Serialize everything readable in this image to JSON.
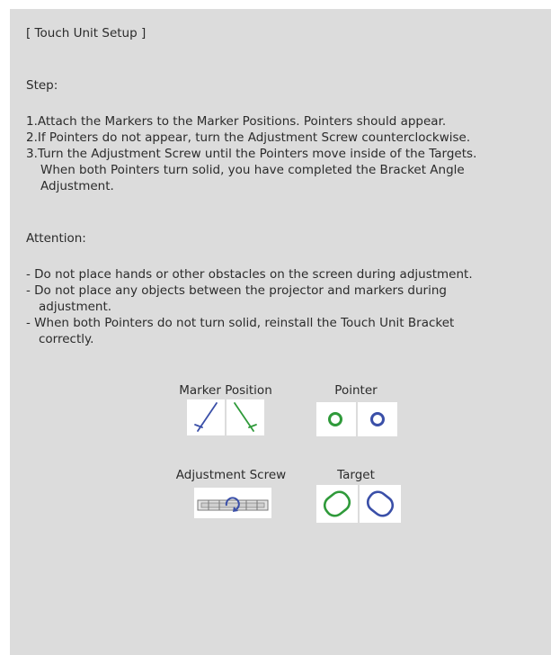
{
  "title": "[ Touch Unit Setup ]",
  "step_heading": "Step:",
  "steps": [
    "1.Attach the Markers to the Marker Positions. Pointers should appear.",
    "2.If Pointers do not appear, turn the Adjustment Screw counterclockwise.",
    "3.Turn the Adjustment Screw until the Pointers move inside of the Targets.",
    "When both Pointers turn solid, you have completed the Bracket Angle",
    "Adjustment."
  ],
  "attention_heading": "Attention:",
  "attentions": [
    "- Do not place hands or other obstacles on the screen during adjustment.",
    "- Do not place any objects between the projector and markers during",
    "adjustment.",
    "- When both Pointers do not turn solid, reinstall the Touch Unit Bracket",
    "correctly."
  ],
  "figures": {
    "marker_position": "Marker Position",
    "pointer": "Pointer",
    "adjustment_screw": "Adjustment Screw",
    "target": "Target"
  },
  "colors": {
    "background": "#dcdcdc",
    "text": "#2b2b2b",
    "blue": "#3a4fa8",
    "green": "#2f9a3a"
  },
  "icons": [
    "marker-blue-icon",
    "marker-green-icon",
    "pointer-green-icon",
    "pointer-blue-icon",
    "adjustment-screw-icon",
    "target-green-icon",
    "target-blue-icon"
  ]
}
